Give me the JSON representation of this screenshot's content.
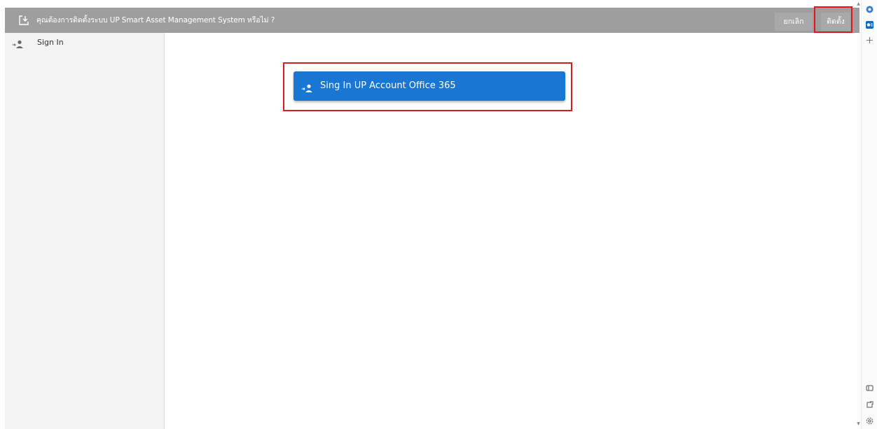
{
  "install_banner": {
    "message": "คุณต้องการติดตั้งระบบ UP Smart Asset Management System หรือไม่ ?",
    "cancel_label": "ยกเลิก",
    "install_label": "ติดตั้ง",
    "icon": "install-download-icon"
  },
  "sidebar": {
    "items": [
      {
        "label": "Sign In",
        "icon": "sign-in-user-icon"
      }
    ]
  },
  "main": {
    "signin_button": {
      "label": "Sing In UP Account Office 365",
      "icon": "sign-in-user-icon"
    }
  },
  "browser_rail": {
    "icons": [
      "copilot-icon",
      "outlook-icon",
      "add-icon",
      "split-screen-icon",
      "open-external-icon",
      "settings-icon"
    ]
  },
  "colors": {
    "banner_bg": "#9e9e9e",
    "primary_button": "#1976d2",
    "highlight_box": "#e0161e",
    "sidebar_bg": "#f3f3f3"
  }
}
